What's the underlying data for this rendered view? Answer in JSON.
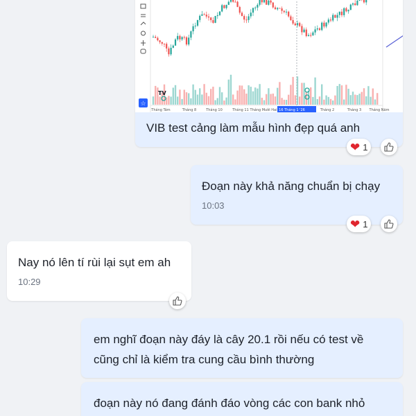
{
  "chart": {
    "x_labels": [
      "Tháng Tám",
      "Tháng 8",
      "Tháng 10",
      "Tháng 11",
      "Tháng Mười Hai",
      "16 Tháng 1 '26",
      "Tháng 2",
      "Tháng 3",
      "Tháng Năm"
    ],
    "watermark": "TV"
  },
  "messages": [
    {
      "caption": "VIB test cảng làm mẫu hình đẹp quá anh",
      "reaction_count": "1"
    },
    {
      "text": "Đoạn này khả năng chuẩn bị chạy",
      "time": "10:03",
      "reaction_count": "1"
    },
    {
      "text": "Nay nó lên tí rùi lại sụt em ah",
      "time": "10:29"
    },
    {
      "text_line1": "em nghĩ đoạn này đáy là cây 20.1 rồi nếu có test về",
      "text_line2": "cũng chỉ là kiểm tra cung cầu bình thường"
    },
    {
      "text_line1": "đoạn này nó đang đánh đáo vòng các con bank nhỏ"
    }
  ],
  "colors": {
    "bubble_me": "#e5efff",
    "bubble_them": "#ffffff",
    "background": "#f0f2f5",
    "candle_up": "#26a69a",
    "candle_down": "#ef5350",
    "trendline": "#5b63d6",
    "heart": "#e0262f"
  }
}
